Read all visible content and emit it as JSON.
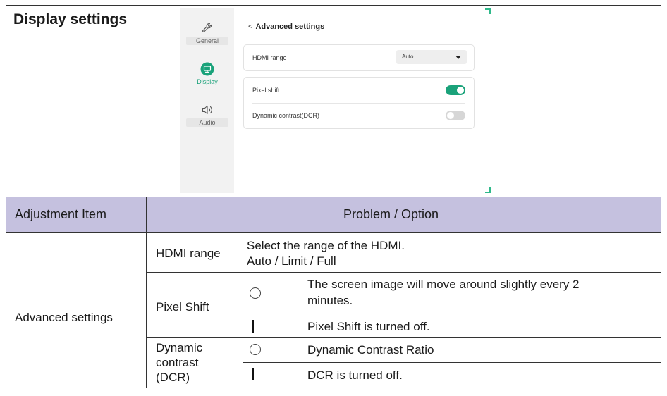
{
  "section_title": "Display settings",
  "screen": {
    "nav": [
      {
        "label": "General",
        "icon": "wrench-icon"
      },
      {
        "label": "Display",
        "icon": "monitor-icon",
        "active": true
      },
      {
        "label": "Audio",
        "icon": "speaker-icon"
      }
    ],
    "title": "Advanced settings",
    "back_glyph": "<",
    "hdmi_range_label": "HDMI range",
    "hdmi_range_value": "Auto",
    "pixel_shift_label": "Pixel shift",
    "pixel_shift_on": true,
    "dcr_label": "Dynamic contrast(DCR)",
    "dcr_on": false,
    "accent_color": "#1aa27a"
  },
  "table": {
    "header_color": "#c5c1df",
    "col_item": "Adjustment Item",
    "col_problem": "Problem / Option",
    "group": "Advanced settings",
    "rows": {
      "hdmi": {
        "name": "HDMI range",
        "line1": "Select the range of the HDMI.",
        "line2": "Auto / Limit / Full"
      },
      "pixel_shift": {
        "name": "Pixel Shift",
        "on_line1": "The screen image will move around slightly every 2",
        "on_line2": "minutes.",
        "off_text": "Pixel Shift is turned off."
      },
      "dcr": {
        "name_line1": "Dynamic",
        "name_line2": "contrast",
        "name_line3": "(DCR)",
        "on_text": "Dynamic Contrast Ratio",
        "off_text": "DCR is turned off."
      }
    }
  }
}
